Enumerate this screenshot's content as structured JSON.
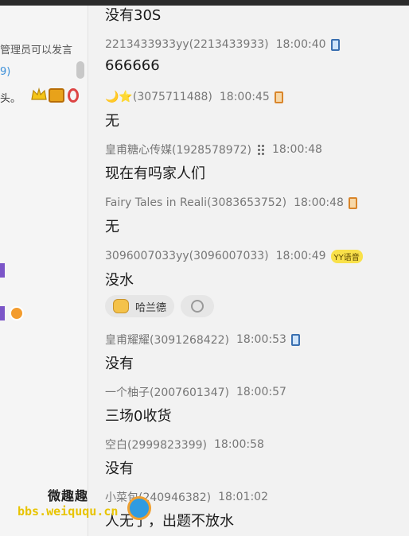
{
  "left_panel": {
    "notice": "管理员可以发言",
    "count": "9)",
    "snippet": "头。"
  },
  "chat": {
    "partial_top": "没有30S",
    "messages": [
      {
        "sender": "2213433933yy(2213433933)",
        "time": "18:00:40",
        "icon": "phone-icon",
        "text": "666666"
      },
      {
        "sender": "(3075711488)",
        "time": "18:00:45",
        "icon": "phone-icon-orange",
        "text": "无",
        "emoji": "🌙⭐"
      },
      {
        "sender": "皇甫糖心传媒(1928578972)",
        "time": "18:00:48",
        "icon": "dots-icon",
        "text": "现在有吗家人们"
      },
      {
        "sender": "Fairy Tales in Reali(3083653752)",
        "time": "18:00:48",
        "icon": "phone-icon-orange",
        "text": "无"
      },
      {
        "sender": "3096007033yy(3096007033)",
        "time": "18:00:49",
        "badge": "YY语音",
        "text": "没水"
      },
      {
        "sender": "皇甫耀耀(3091268422)",
        "time": "18:00:53",
        "icon": "phone-icon",
        "text": "没有"
      },
      {
        "sender": "一个柚子(2007601347)",
        "time": "18:00:57",
        "text": "三场0收货"
      },
      {
        "sender": "空白(2999823399)",
        "time": "18:00:58",
        "text": "没有"
      },
      {
        "sender": "小菜包(240946382)",
        "time": "18:01:02",
        "text": "人无了，出题不放水"
      }
    ],
    "reaction_name": "哈兰德"
  },
  "watermark": {
    "top": "微趣趣",
    "bottom": "bbs.weiququ.cn"
  }
}
